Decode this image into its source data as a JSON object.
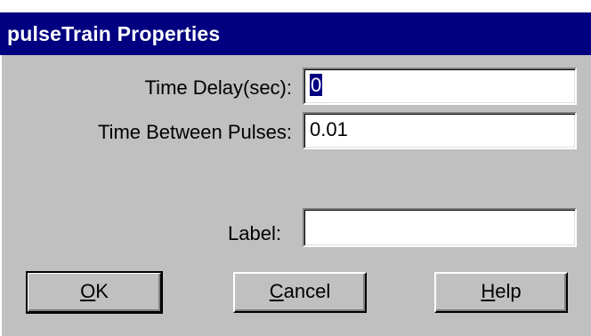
{
  "dialog": {
    "title": "pulseTrain Properties"
  },
  "fields": {
    "time_delay": {
      "label": "Time Delay(sec):",
      "value": "0"
    },
    "time_between": {
      "label": "Time Between Pulses:",
      "value": "0.01"
    },
    "label": {
      "label": "Label:",
      "value": ""
    }
  },
  "buttons": {
    "ok": {
      "mnemonic": "O",
      "rest": "K"
    },
    "cancel": {
      "mnemonic": "C",
      "rest": "ancel"
    },
    "help": {
      "mnemonic": "H",
      "rest": "elp"
    }
  }
}
